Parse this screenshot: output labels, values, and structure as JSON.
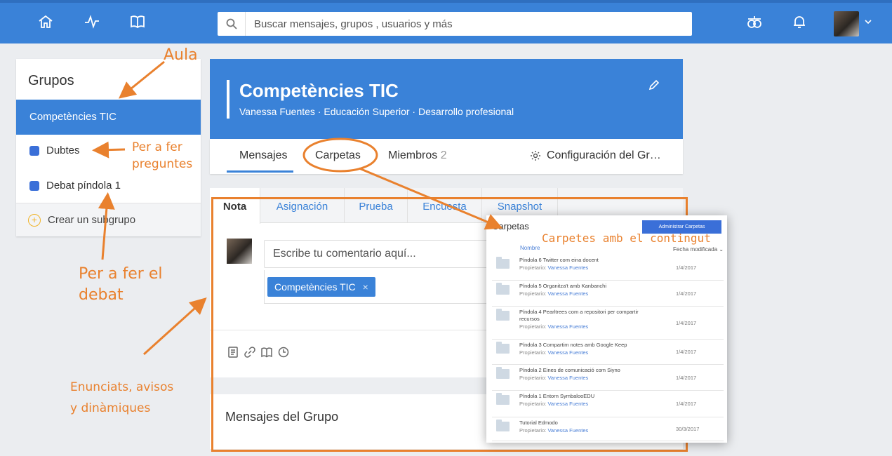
{
  "topbar": {
    "icons": [
      "home-icon",
      "activity-icon",
      "library-icon"
    ],
    "search_placeholder": "Buscar mensajes, grupos , usuarios y más",
    "right_icons": [
      "backpack-icon",
      "bell-icon",
      "chevron-down-icon"
    ]
  },
  "sidebar": {
    "title": "Grupos",
    "active_group": "Competències TIC",
    "subgroups": [
      "Dubtes",
      "Debat píndola 1"
    ],
    "create_label": "Crear un subgrupo"
  },
  "group": {
    "name": "Competències TIC",
    "meta": "Vanessa Fuentes · Educación Superior · Desarrollo profesional",
    "tabs": {
      "mensajes": "Mensajes",
      "carpetas": "Carpetas",
      "miembros": "Miembros",
      "miembros_count": "2",
      "config": "Configuración del Gr…"
    }
  },
  "composer": {
    "post_tabs": [
      "Nota",
      "Asignación",
      "Prueba",
      "Encuesta",
      "Snapshot"
    ],
    "comment_placeholder": "Escribe tu comentario aquí...",
    "recipient_chip": "Competències TIC",
    "chip_close": "×",
    "messages_title": "Mensajes del Grupo"
  },
  "carpetas_popup": {
    "title": "Carpetas",
    "manage_button": "Administrar Carpetas",
    "col_name": "Nombre",
    "col_date": "Fecha modificada ⌄",
    "owner_label": "Propietario:",
    "folders": [
      {
        "name": "Píndola 6 Twitter com eina docent",
        "owner": "Vanessa Fuentes",
        "date": "1/4/2017"
      },
      {
        "name": "Píndola 5 Organitza't amb Kanbanchi",
        "owner": "Vanessa Fuentes",
        "date": "1/4/2017"
      },
      {
        "name": "Píndola 4 Pearltrees com a repositori per compartir recursos",
        "owner": "Vanessa Fuentes",
        "date": "1/4/2017"
      },
      {
        "name": "Píndola 3 Compartim notes amb Google Keep",
        "owner": "Vanessa Fuentes",
        "date": "1/4/2017"
      },
      {
        "name": "Píndola 2 Eines de comunicació com Siyno",
        "owner": "Vanessa Fuentes",
        "date": "1/4/2017"
      },
      {
        "name": "Píndola 1 Entorn SymbalooEDU",
        "owner": "Vanessa Fuentes",
        "date": "1/4/2017"
      },
      {
        "name": "Tutorial Edmodo",
        "owner": "Vanessa Fuentes",
        "date": "30/3/2017"
      }
    ]
  },
  "annotations": {
    "aula": "Aula",
    "preguntes_1": "Per a fer",
    "preguntes_2": "preguntes",
    "debat_1": "Per a fer el",
    "debat_2": "debat",
    "enunciats_1": "Enunciats, avisos",
    "enunciats_2": "y dinàmiques",
    "carpetes": "Carpetes amb el contingut"
  },
  "colors": {
    "brand_blue": "#3a82d8",
    "annotation_orange": "#e9812e"
  }
}
